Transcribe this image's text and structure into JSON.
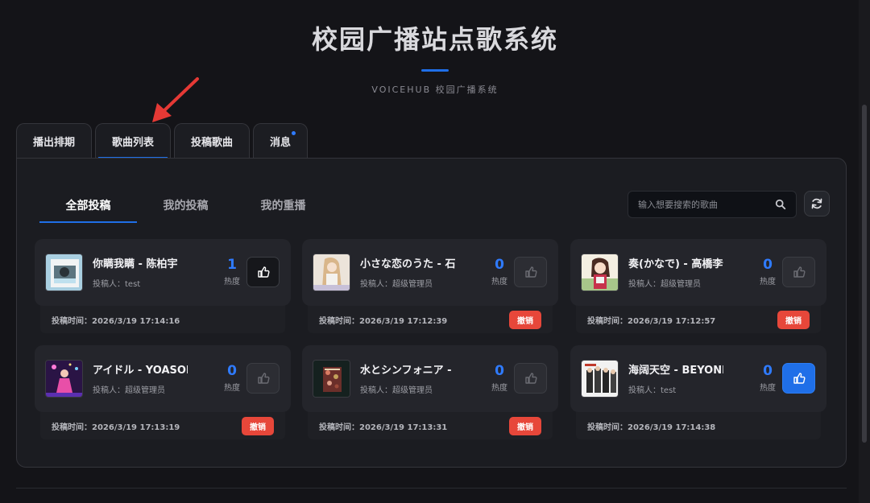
{
  "header": {
    "title": "校园广播站点歌系统",
    "subtitle": "VOICEHUB 校园广播系统"
  },
  "tabs": [
    {
      "label": "播出排期"
    },
    {
      "label": "歌曲列表",
      "active": true
    },
    {
      "label": "投稿歌曲"
    },
    {
      "label": "消息",
      "has_notification": true
    }
  ],
  "subtabs": [
    {
      "label": "全部投稿",
      "active": true
    },
    {
      "label": "我的投稿"
    },
    {
      "label": "我的重播"
    }
  ],
  "search": {
    "placeholder": "输入想要搜索的歌曲"
  },
  "heat_label": "热度",
  "submitter_prefix": "投稿人：",
  "time_prefix": "投稿时间：",
  "revoke_label": "撤销",
  "colors": {
    "accent": "#1f6fe8",
    "revoke": "#e7473a",
    "heat": "#2f7bff"
  },
  "songs": [
    {
      "title": "你瞒我瞒 - 陈柏宇",
      "submitter": "test",
      "heat": "1",
      "time": "2026/3/19 17:14:16",
      "revokable": false,
      "like_state": "dark"
    },
    {
      "title": "小さな恋のうた - 石!",
      "submitter": "超级管理员",
      "heat": "0",
      "time": "2026/3/19 17:12:39",
      "revokable": true,
      "like_state": "disabled"
    },
    {
      "title": "奏(かなで) - 高橋李依",
      "submitter": "超级管理员",
      "heat": "0",
      "time": "2026/3/19 17:12:57",
      "revokable": true,
      "like_state": "disabled"
    },
    {
      "title": "アイドル - YOASOBI",
      "submitter": "超级管理员",
      "heat": "0",
      "time": "2026/3/19 17:13:19",
      "revokable": true,
      "like_state": "disabled"
    },
    {
      "title": "水とシンフォニア - k",
      "submitter": "超级管理员",
      "heat": "0",
      "time": "2026/3/19 17:13:31",
      "revokable": true,
      "like_state": "disabled"
    },
    {
      "title": "海阔天空 - BEYOND",
      "submitter": "test",
      "heat": "0",
      "time": "2026/3/19 17:14:38",
      "revokable": false,
      "like_state": "blue"
    }
  ]
}
